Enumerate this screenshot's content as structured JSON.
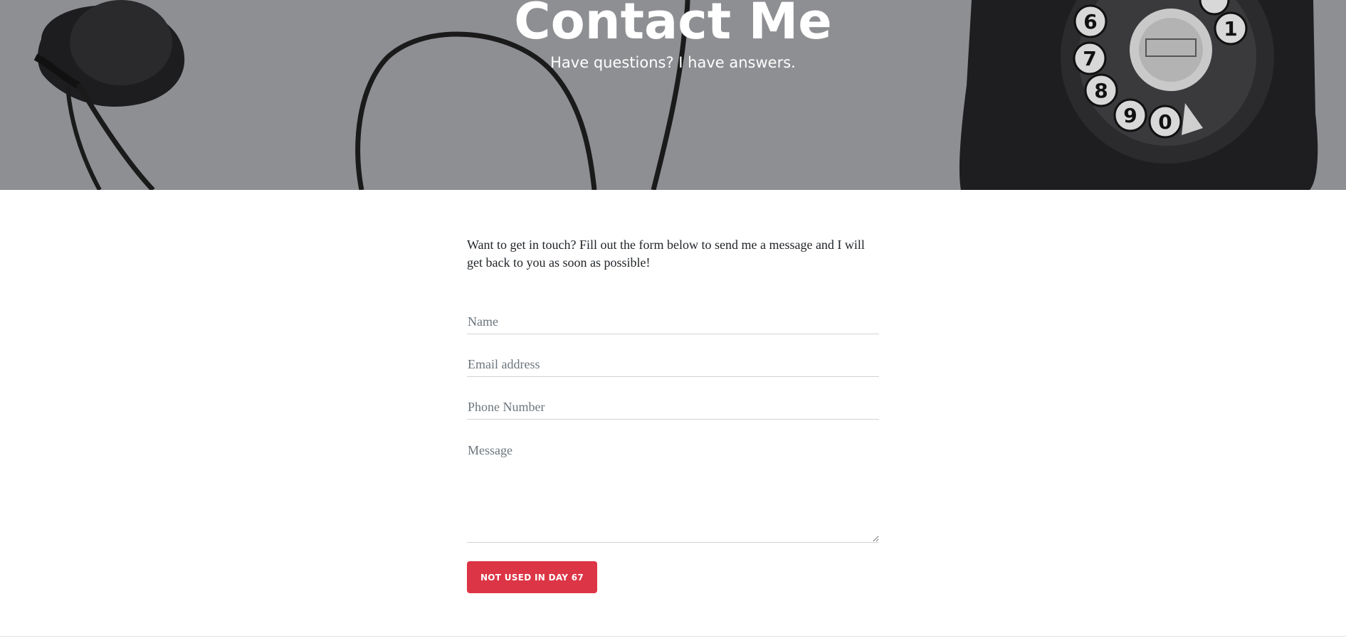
{
  "header": {
    "title": "Contact Me",
    "subtitle": "Have questions? I have answers."
  },
  "intro": {
    "text": "Want to get in touch? Fill out the form below to send me a message and I will get back to you as soon as possible!"
  },
  "form": {
    "name_placeholder": "Name",
    "email_placeholder": "Email address",
    "phone_placeholder": "Phone Number",
    "message_placeholder": "Message",
    "submit_label": "NOT USED IN DAY 67"
  },
  "colors": {
    "accent": "#dc3545",
    "hero_overlay": "#8e8f92"
  },
  "icons": {
    "hero_image": "vintage-rotary-telephone-image"
  }
}
